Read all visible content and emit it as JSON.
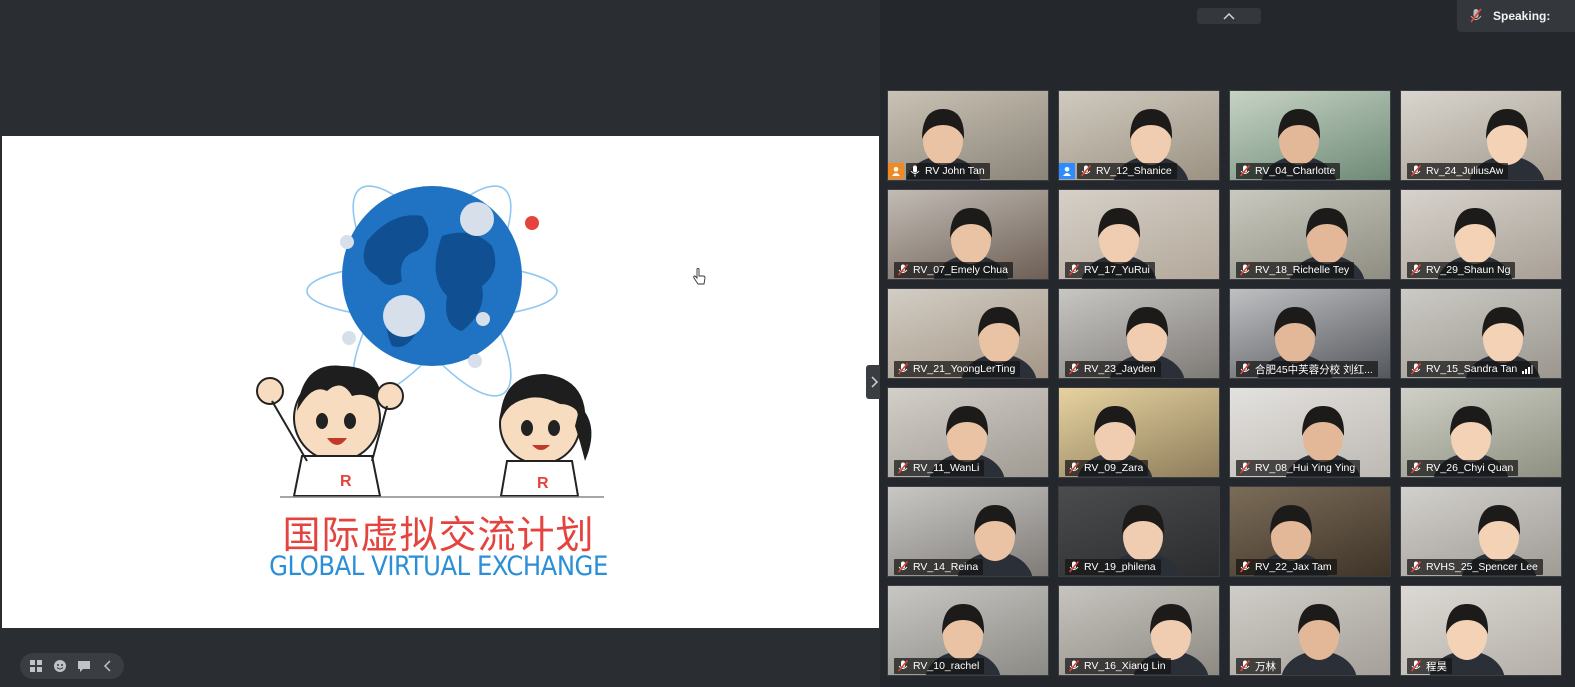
{
  "header": {
    "speaking_label": "Speaking:",
    "collapse_icon": "chevron-up-icon"
  },
  "slide": {
    "title_cn": "国际虚拟交流计划",
    "title_en": "GLOBAL VIRTUAL EXCHANGE"
  },
  "colors": {
    "title_cn": "#e5433d",
    "title_en": "#2a8fd6",
    "globe": "#1f73c2",
    "app_bg": "#24272b"
  },
  "participants": [
    {
      "name": "RV John Tan",
      "mic": "on",
      "badge": "orange"
    },
    {
      "name": "RV_12_Shanice",
      "mic": "muted",
      "badge": "blue"
    },
    {
      "name": "RV_04_Charlotte",
      "mic": "muted"
    },
    {
      "name": "Rv_24_JuliusAw",
      "mic": "muted"
    },
    {
      "name": "RV_07_Emely Chua",
      "mic": "muted"
    },
    {
      "name": "RV_17_YuRui",
      "mic": "muted"
    },
    {
      "name": "RV_18_Richelle Tey",
      "mic": "muted"
    },
    {
      "name": "RV_29_Shaun Ng",
      "mic": "muted"
    },
    {
      "name": "RV_21_YoongLerTing",
      "mic": "muted"
    },
    {
      "name": "RV_23_Jayden",
      "mic": "muted"
    },
    {
      "name": "合肥45中芙蓉分校  刘红...",
      "mic": "muted"
    },
    {
      "name": "RV_15_Sandra Tan",
      "mic": "muted",
      "signal": true
    },
    {
      "name": "RV_11_WanLi",
      "mic": "muted"
    },
    {
      "name": "RV_09_Zara",
      "mic": "muted"
    },
    {
      "name": "RV_08_Hui Ying Ying",
      "mic": "muted"
    },
    {
      "name": "RV_26_Chyi Quan",
      "mic": "muted"
    },
    {
      "name": "RV_14_Reina",
      "mic": "muted"
    },
    {
      "name": "RV_19_philena",
      "mic": "muted"
    },
    {
      "name": "RV_22_Jax Tam",
      "mic": "muted"
    },
    {
      "name": "RVHS_25_Spencer Lee",
      "mic": "muted"
    },
    {
      "name": "RV_10_rachel",
      "mic": "muted"
    },
    {
      "name": "RV_16_Xiang Lin",
      "mic": "muted"
    },
    {
      "name": "万林",
      "mic": "muted"
    },
    {
      "name": "程昊",
      "mic": "muted"
    }
  ]
}
